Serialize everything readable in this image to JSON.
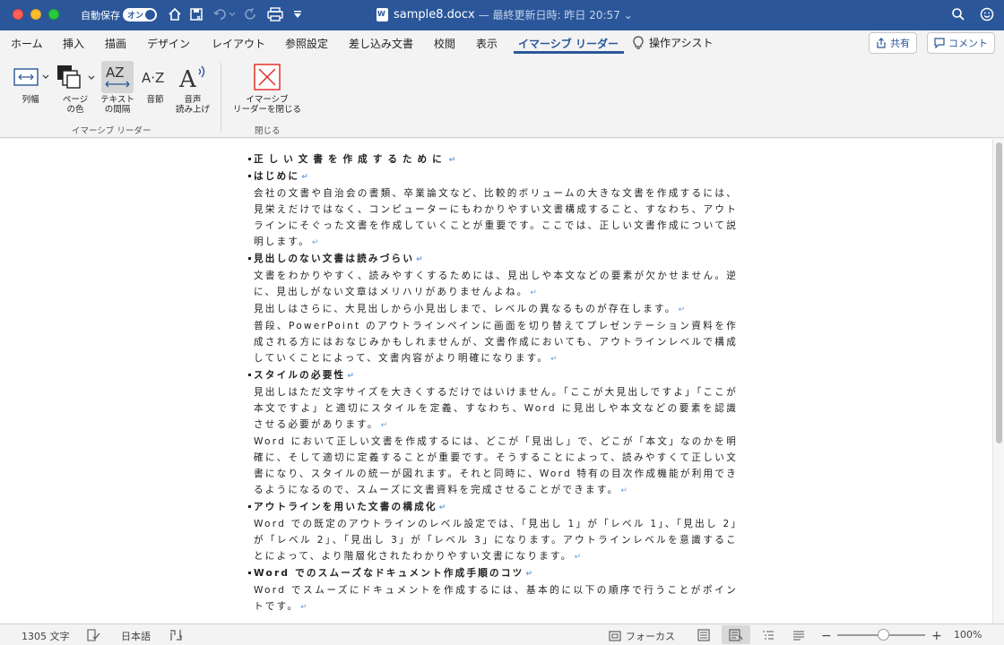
{
  "window": {
    "autosave_label": "自動保存",
    "autosave_toggle": "オン",
    "doc_name": "sample8.docx",
    "doc_status": "— 最終更新日時: 昨日 20:57"
  },
  "tabs": [
    "ホーム",
    "挿入",
    "描画",
    "デザイン",
    "レイアウト",
    "参照設定",
    "差し込み文書",
    "校閲",
    "表示",
    "イマーシブ リーダー"
  ],
  "assist_label": "操作アシスト",
  "share_label": "共有",
  "comment_label": "コメント",
  "ribbon": {
    "buttons": [
      {
        "l1": "列幅",
        "l2": ""
      },
      {
        "l1": "ページ",
        "l2": "の色"
      },
      {
        "l1": "テキスト",
        "l2": "の間隔"
      },
      {
        "l1": "音節",
        "l2": ""
      },
      {
        "l1": "音声",
        "l2": "読み上げ"
      },
      {
        "l1": "イマーシブ",
        "l2": "リーダーを閉じる"
      }
    ],
    "group1": "イマーシブ リーダー",
    "group2": "閉じる"
  },
  "document": {
    "title": "正しい文書を作成するために",
    "h1": "はじめに",
    "p1": "会社の文書や自治会の書類、卒業論文など、比較的ボリュームの大きな文書を作成するには、見栄えだけではなく、コンピューターにもわかりやすい文書構成すること、すなわち、アウトラインにそぐった文書を作成していくことが重要です。ここでは、正しい文書作成について説明します。",
    "h2": "見出しのない文書は読みづらい",
    "p2": "文書をわかりやすく、読みやすくするためには、見出しや本文などの要素が欠かせません。逆に、見出しがない文章はメリハリがありませんよね。",
    "p3": "見出しはさらに、大見出しから小見出しまで、レベルの異なるものが存在します。",
    "p4": "普段、PowerPoint のアウトラインペインに画面を切り替えてプレゼンテーション資料を作成される方にはおなじみかもしれませんが、文書作成においても、アウトラインレベルで構成していくことによって、文書内容がより明確になります。",
    "h3": "スタイルの必要性",
    "p5": "見出しはただ文字サイズを大きくするだけではいけません。「ここが大見出しですよ」「ここが本文ですよ」と適切にスタイルを定義、すなわち、Word に見出しや本文などの要素を認識させる必要があります。",
    "p6": "Word において正しい文書を作成するには、どこが「見出し」で、どこが「本文」なのかを明確に、そして適切に定義することが重要です。そうすることによって、読みやすくて正しい文書になり、スタイルの統一が図れます。それと同時に、Word 特有の目次作成機能が利用できるようになるので、スムーズに文書資料を完成させることができます。",
    "h4": "アウトラインを用いた文書の構成化",
    "p7": "Word での既定のアウトラインのレベル設定では、「見出し 1」が「レベル 1」、「見出し 2」が「レベル 2」、「見出し 3」が「レベル 3」になります。アウトラインレベルを意識することによって、より階層化されたわかりやすい文書になります。",
    "h5": "Word でのスムーズなドキュメント作成手順のコツ",
    "p8": "Word でスムーズにドキュメントを作成するには、基本的に以下の順序で行うことがポイントです。"
  },
  "status": {
    "word_count": "1305 文字",
    "language": "日本語",
    "focus": "フォーカス",
    "zoom": "100%",
    "zoom_fraction": 0.5
  }
}
